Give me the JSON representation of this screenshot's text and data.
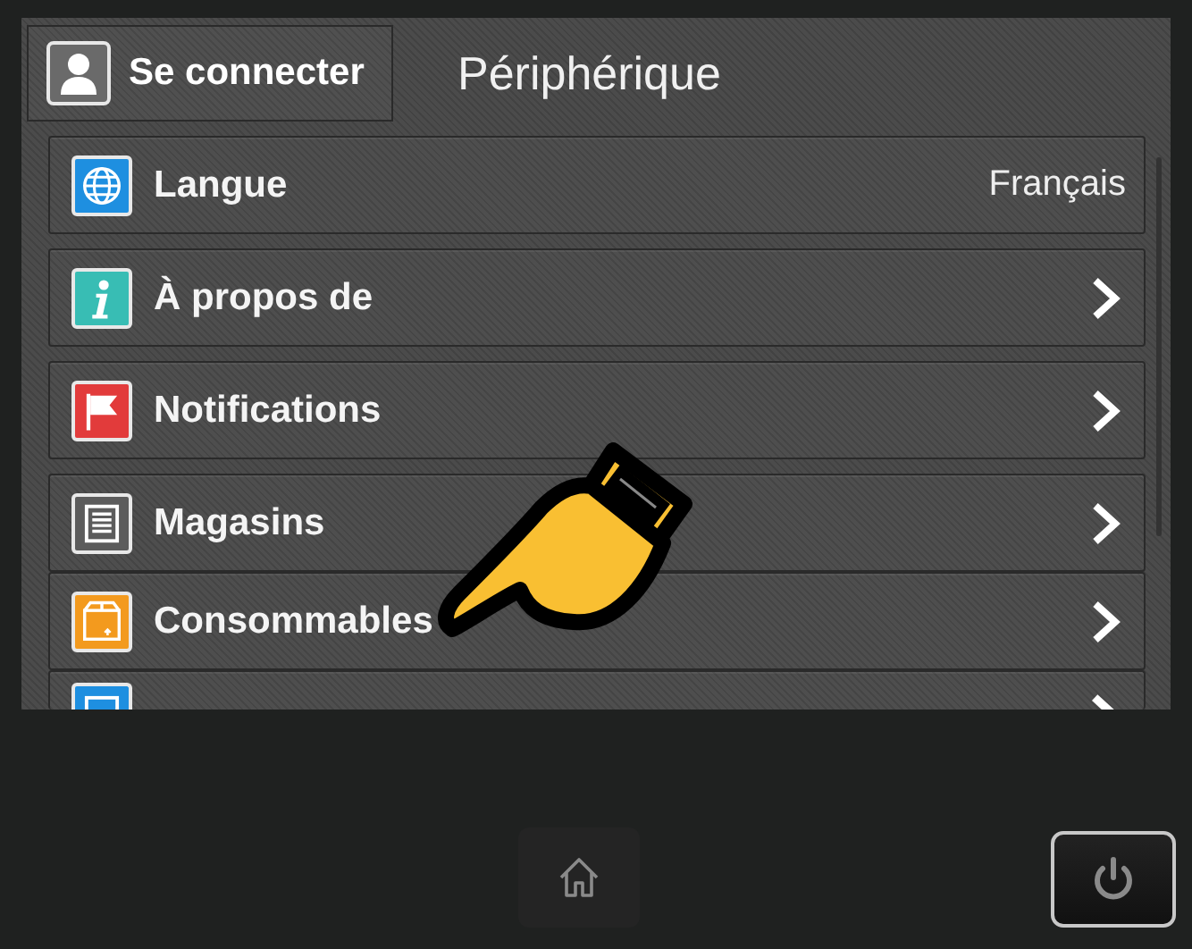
{
  "header": {
    "sign_in": "Se connecter",
    "title": "Périphérique"
  },
  "items": [
    {
      "kind": "value",
      "color": "#1e8fe0",
      "label": "Langue",
      "value": "Français"
    },
    {
      "kind": "link",
      "color": "#38bdb4",
      "label": "À propos de"
    },
    {
      "kind": "link",
      "color": "#e23b3b",
      "label": "Notifications"
    },
    {
      "kind": "link",
      "color": "#5c5c5c",
      "label": "Magasins"
    },
    {
      "kind": "link",
      "color": "#f39a1e",
      "label": "Consommables"
    },
    {
      "kind": "link",
      "color": "#1e8fe0"
    }
  ]
}
